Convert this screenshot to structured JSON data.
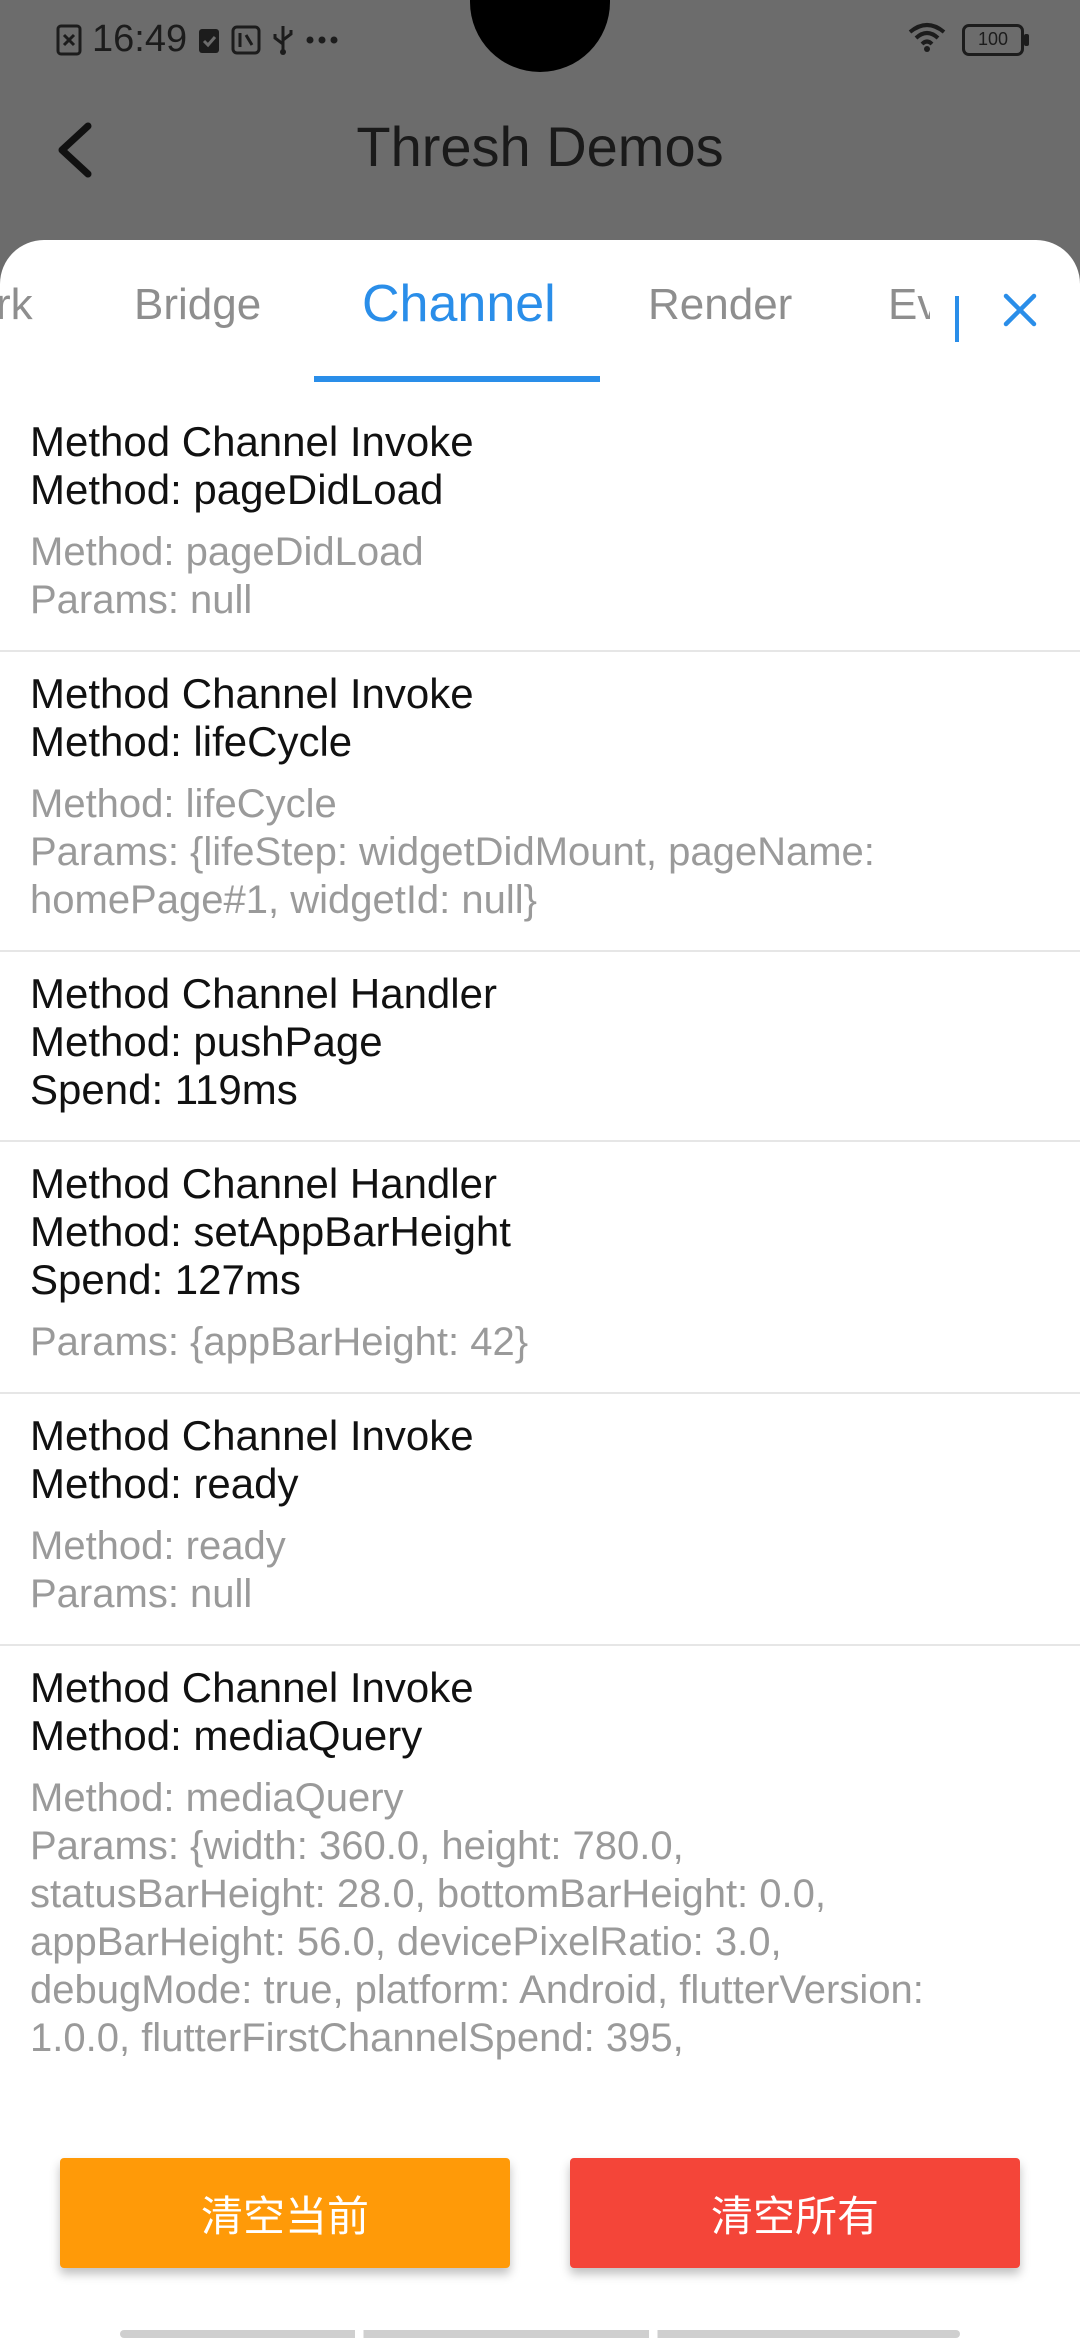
{
  "status_bar": {
    "time": "16:49",
    "battery": "100"
  },
  "app_bar": {
    "title": "Thresh Demos"
  },
  "tabs": [
    {
      "label": "rk"
    },
    {
      "label": "Bridge"
    },
    {
      "label": "Channel",
      "active": true
    },
    {
      "label": "Render"
    },
    {
      "label": "Ev"
    }
  ],
  "logs": [
    {
      "title": "Method Channel Invoke\nMethod: pageDidLoad",
      "detail": "Method: pageDidLoad\nParams: null"
    },
    {
      "title": "Method Channel Invoke\nMethod: lifeCycle",
      "detail": "Method: lifeCycle\nParams: {lifeStep: widgetDidMount, pageName:\nhomePage#1, widgetId: null}"
    },
    {
      "title": "Method Channel Handler\nMethod: pushPage\nSpend: 119ms",
      "detail": ""
    },
    {
      "title": "Method Channel Handler\nMethod: setAppBarHeight\nSpend: 127ms",
      "detail": "Params: {appBarHeight: 42}"
    },
    {
      "title": "Method Channel Invoke\nMethod: ready",
      "detail": "Method: ready\nParams: null"
    },
    {
      "title": "Method Channel Invoke\nMethod: mediaQuery",
      "detail": "Method: mediaQuery\nParams: {width: 360.0, height: 780.0,\nstatusBarHeight: 28.0, bottomBarHeight: 0.0,\nappBarHeight: 56.0, devicePixelRatio: 3.0,\ndebugMode: true, platform: Android, flutterVersion:\n1.0.0, flutterFirstChannelSpend: 395,"
    }
  ],
  "actions": {
    "clear_current": "清空当前",
    "clear_all": "清空所有"
  },
  "colors": {
    "accent": "#2a8ee9",
    "orange_button": "#ff9a08",
    "red_button": "#f44539"
  }
}
